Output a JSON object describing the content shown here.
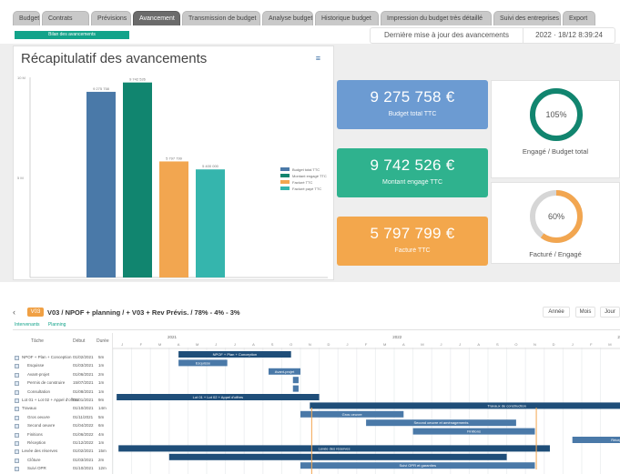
{
  "tabs": [
    {
      "label": "Budget",
      "active": false
    },
    {
      "label": "Contrats",
      "active": false
    },
    {
      "label": "Prévisions",
      "active": false
    },
    {
      "label": "Avancement",
      "active": true
    },
    {
      "label": "Transmission de budget",
      "active": false
    },
    {
      "label": "Analyse budget",
      "active": false
    },
    {
      "label": "Historique budget",
      "active": false
    },
    {
      "label": "Impression du budget très détaillé",
      "active": false
    },
    {
      "label": "Suivi des entreprises",
      "active": false
    },
    {
      "label": "Export",
      "active": false
    }
  ],
  "top_pill": "Bilan des avancements",
  "last_update": {
    "label": "Dernière mise à jour des avancements",
    "value": "2022 · 18/12 8:39:24"
  },
  "chart_title": "Récapitulatif des avancements",
  "chart_data": {
    "type": "bar",
    "categories": [
      "Budget total TTC",
      "Montant engagé TTC",
      "Facturé TTC",
      "Facturé payé TTC"
    ],
    "values": [
      9275758,
      9742526,
      5797799,
      5400000
    ],
    "data_labels": [
      "9 275 758",
      "9 742 526",
      "5 797 799",
      "5 400 000"
    ],
    "colors": [
      "#4a79a8",
      "#11856f",
      "#f2a650",
      "#35b5ad"
    ],
    "ylim": [
      0,
      10000000
    ],
    "y_ticks": [
      "10 M",
      "5 M"
    ],
    "legend": [
      "Budget total TTC",
      "Montant engagé TTC",
      "Facturé TTC",
      "Facturé payé TTC"
    ],
    "legend_position": "right",
    "grid": false
  },
  "kpis": [
    {
      "value": "9 275 758 €",
      "label": "Budget total TTC",
      "color": "#6c9bd2"
    },
    {
      "value": "9 742 526 €",
      "label": "Montant engagé TTC",
      "color": "#2fb28e"
    },
    {
      "value": "5 797 799 €",
      "label": "Facturé TTC",
      "color": "#f3a74c"
    }
  ],
  "rings": [
    {
      "percent": 105,
      "pct_label": "105%",
      "caption": "Engagé / Budget total",
      "color": "#11856f"
    },
    {
      "percent": 60,
      "pct_label": "60%",
      "caption": "Facturé / Engagé",
      "color": "#f2a650"
    }
  ],
  "gantt": {
    "back": "‹",
    "badge": "V03",
    "title": "V03 / NPOF + planning / + V03 + Rev Prévis. / 78% - 4% - 3%",
    "buttons": [
      "Année",
      "Mois",
      "Jour"
    ],
    "subtabs": [
      "Intervenants",
      "Planning"
    ],
    "columns": [
      "Tâche",
      "Début",
      "Durée"
    ],
    "months": [
      "J",
      "F",
      "M",
      "A",
      "M",
      "J",
      "J",
      "A",
      "S",
      "O",
      "N",
      "D",
      "J",
      "F",
      "M",
      "A",
      "M",
      "J",
      "J",
      "A",
      "S",
      "O",
      "N",
      "D",
      "J",
      "F",
      "M"
    ],
    "years": [
      "2021",
      "2022",
      "2023"
    ],
    "rows": [
      {
        "name": "NPOF + Plan + Conception",
        "date": "01/02/2021",
        "dur": "5m"
      },
      {
        "name": "Esquisse",
        "date": "01/03/2021",
        "dur": "1m"
      },
      {
        "name": "Avant-projet",
        "date": "01/06/2021",
        "dur": "2m"
      },
      {
        "name": "Permis de construire",
        "date": "15/07/2021",
        "dur": "1m"
      },
      {
        "name": "Consultation",
        "date": "01/08/2021",
        "dur": "1m"
      },
      {
        "name": "Lot 01 + Lot 02 + Appel d'offres",
        "date": "01/01/2021",
        "dur": "9m"
      },
      {
        "name": "Travaux",
        "date": "01/10/2021",
        "dur": "14m"
      },
      {
        "name": "Gros oeuvre",
        "date": "01/11/2021",
        "dur": "5m"
      },
      {
        "name": "Second oeuvre",
        "date": "01/04/2022",
        "dur": "6m"
      },
      {
        "name": "Finitions",
        "date": "01/06/2022",
        "dur": "4m"
      },
      {
        "name": "Réception",
        "date": "01/12/2022",
        "dur": "1m"
      },
      {
        "name": "Levée des réserves",
        "date": "01/02/2021",
        "dur": "15m"
      },
      {
        "name": "Clôture",
        "date": "01/03/2021",
        "dur": "2m"
      },
      {
        "name": "Suivi OPR",
        "date": "01/10/2021",
        "dur": "12m"
      }
    ],
    "bars": [
      {
        "label": "NPOF + Plan + Conception",
        "color": "#1f4e79"
      },
      {
        "label": "Esquisse",
        "color": "#4a79a8"
      },
      {
        "label": "Avant-projet",
        "color": "#4a79a8"
      },
      {
        "label": "",
        "color": "#4a79a8"
      },
      {
        "label": "",
        "color": "#4a79a8"
      },
      {
        "label": "Lot 01 + Lot 02 + Appel d'offres",
        "color": "#1f4e79"
      },
      {
        "label": "Travaux de construction",
        "color": "#1f4e79"
      },
      {
        "label": "Gros oeuvre",
        "color": "#4a79a8"
      },
      {
        "label": "Second oeuvre et aménagements",
        "color": "#4a79a8"
      },
      {
        "label": "Finitions",
        "color": "#4a79a8"
      },
      {
        "label": "Réception",
        "color": "#4a79a8"
      },
      {
        "label": "Levée des réserves",
        "color": "#1f4e79"
      },
      {
        "label": "",
        "color": "#1f4e79"
      },
      {
        "label": "Suivi OPR et garanties",
        "color": "#4a79a8"
      }
    ]
  }
}
